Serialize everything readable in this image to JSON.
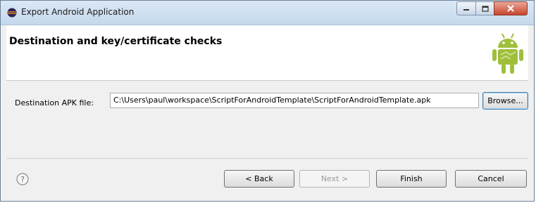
{
  "window": {
    "title": "Export Android Application"
  },
  "header": {
    "title": "Destination and key/certificate checks"
  },
  "form": {
    "destination_label": "Destination APK file:",
    "destination_value": "C:\\Users\\paul\\workspace\\ScriptForAndroidTemplate\\ScriptForAndroidTemplate.apk",
    "browse_label": "Browse..."
  },
  "footer": {
    "back_label": "< Back",
    "next_label": "Next >",
    "finish_label": "Finish",
    "cancel_label": "Cancel"
  },
  "colors": {
    "android_green": "#9fbf3b",
    "titlebar": "#c4d8ec"
  },
  "icons": [
    "eclipse-app-icon",
    "minimize-icon",
    "maximize-icon",
    "close-icon",
    "android-logo",
    "help-icon"
  ]
}
